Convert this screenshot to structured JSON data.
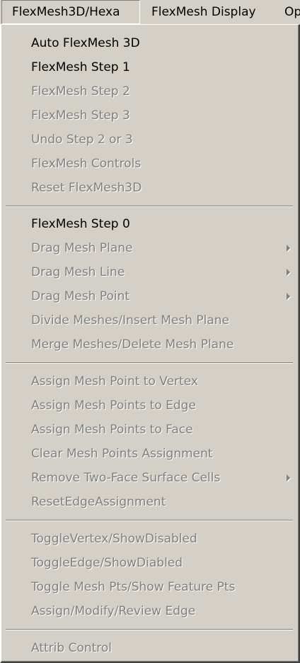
{
  "menubar": {
    "items": [
      {
        "label": "FlexMesh3D/Hexa"
      },
      {
        "label": "FlexMesh Display"
      },
      {
        "label": "Op"
      }
    ]
  },
  "menu": {
    "groups": [
      {
        "items": [
          {
            "label": "Auto FlexMesh 3D",
            "enabled": true
          },
          {
            "label": "FlexMesh Step 1",
            "enabled": true
          },
          {
            "label": "FlexMesh Step 2",
            "enabled": false
          },
          {
            "label": "FlexMesh Step 3",
            "enabled": false
          },
          {
            "label": "Undo Step 2 or 3",
            "enabled": false
          },
          {
            "label": "FlexMesh Controls",
            "enabled": false
          },
          {
            "label": "Reset FlexMesh3D",
            "enabled": false
          }
        ]
      },
      {
        "items": [
          {
            "label": "FlexMesh Step 0",
            "enabled": true
          },
          {
            "label": "Drag Mesh Plane",
            "enabled": false,
            "submenu": true
          },
          {
            "label": "Drag Mesh Line",
            "enabled": false,
            "submenu": true
          },
          {
            "label": "Drag Mesh Point",
            "enabled": false,
            "submenu": true
          },
          {
            "label": "Divide Meshes/Insert Mesh Plane",
            "enabled": false
          },
          {
            "label": "Merge Meshes/Delete Mesh Plane",
            "enabled": false
          }
        ]
      },
      {
        "items": [
          {
            "label": "Assign Mesh Point to Vertex",
            "enabled": false
          },
          {
            "label": "Assign Mesh Points to Edge",
            "enabled": false
          },
          {
            "label": "Assign Mesh Points to Face",
            "enabled": false
          },
          {
            "label": "Clear Mesh Points Assignment",
            "enabled": false
          },
          {
            "label": "Remove Two-Face Surface Cells",
            "enabled": false,
            "submenu": true
          },
          {
            "label": "ResetEdgeAssignment",
            "enabled": false
          }
        ]
      },
      {
        "items": [
          {
            "label": "ToggleVertex/ShowDisabled",
            "enabled": false
          },
          {
            "label": "ToggleEdge/ShowDiabled",
            "enabled": false
          },
          {
            "label": "Toggle Mesh Pts/Show Feature Pts",
            "enabled": false
          },
          {
            "label": "Assign/Modify/Review Edge",
            "enabled": false
          }
        ]
      },
      {
        "items": [
          {
            "label": "Attrib Control",
            "enabled": false
          }
        ]
      }
    ]
  }
}
